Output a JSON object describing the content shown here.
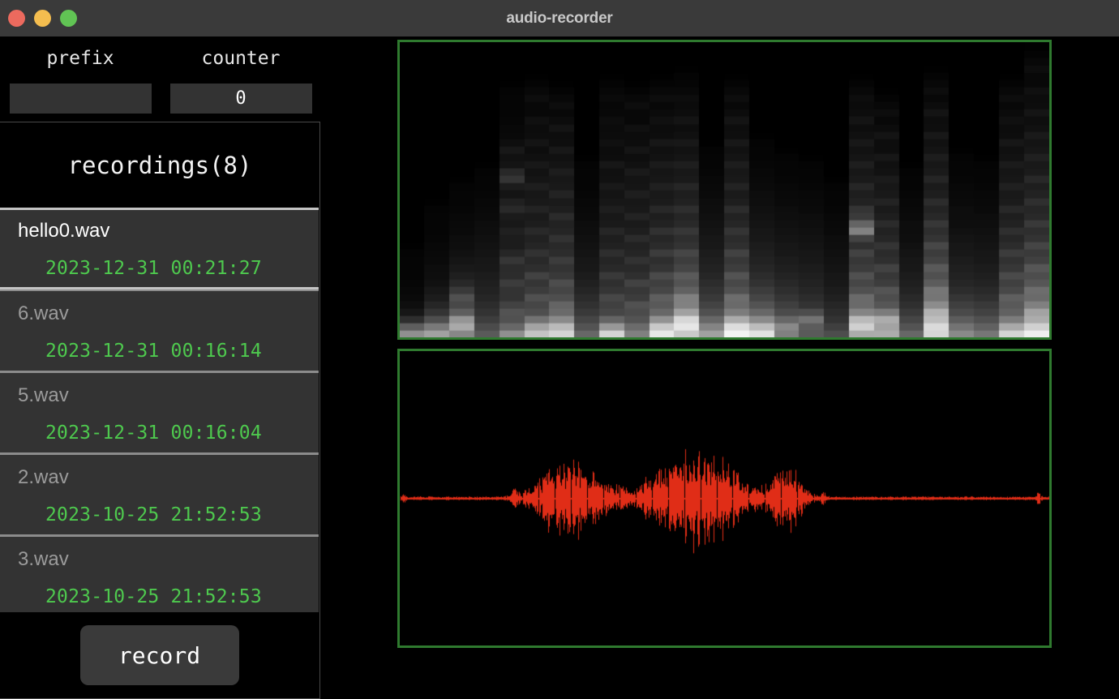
{
  "window": {
    "title": "audio-recorder",
    "traffic_lights": [
      {
        "name": "close-button",
        "color": "#ec6a5e"
      },
      {
        "name": "minimize-button",
        "color": "#f4bd4f"
      },
      {
        "name": "maximize-button",
        "color": "#61c454"
      }
    ],
    "titlebar_color": "#3a3a3a"
  },
  "form": {
    "prefix_label": "prefix",
    "counter_label": "counter",
    "prefix_value": "",
    "prefix_placeholder": "",
    "counter_value": "0"
  },
  "recordings": {
    "header": "recordings(8)",
    "count": 8,
    "items": [
      {
        "name": "hello0.wav",
        "timestamp": "2023-12-31 00:21:27",
        "selected": true
      },
      {
        "name": "6.wav",
        "timestamp": "2023-12-31 00:16:14",
        "selected": false
      },
      {
        "name": "5.wav",
        "timestamp": "2023-12-31 00:16:04",
        "selected": false
      },
      {
        "name": "2.wav",
        "timestamp": "2023-10-25 21:52:53",
        "selected": false
      },
      {
        "name": "3.wav",
        "timestamp": "2023-10-25 21:52:53",
        "selected": false
      }
    ]
  },
  "controls": {
    "record_label": "record"
  },
  "visualization": {
    "border_color": "#2f7a2f",
    "background_color": "#000000",
    "waveform_color": "#e02d17",
    "spectrogram_colormap": "grayscale",
    "spectrogram": {
      "columns": 26,
      "bins": 40,
      "magnitudes": [
        [
          0.55,
          0.28,
          0.1,
          0.05,
          0.03,
          0.02,
          0.02,
          0.01,
          0.01,
          0.01,
          0.01,
          0.01,
          0.0,
          0.0,
          0.0,
          0.0,
          0.0,
          0.0,
          0.0,
          0.0,
          0.0,
          0.0,
          0.0,
          0.0,
          0.0,
          0.0,
          0.0,
          0.0,
          0.0,
          0.0,
          0.0,
          0.0,
          0.0,
          0.0,
          0.0,
          0.0,
          0.0,
          0.0,
          0.0,
          0.0
        ],
        [
          0.62,
          0.4,
          0.22,
          0.14,
          0.1,
          0.07,
          0.05,
          0.04,
          0.03,
          0.03,
          0.02,
          0.02,
          0.02,
          0.01,
          0.01,
          0.01,
          0.01,
          0.01,
          0.0,
          0.0,
          0.0,
          0.0,
          0.0,
          0.0,
          0.0,
          0.0,
          0.0,
          0.0,
          0.0,
          0.0,
          0.0,
          0.0,
          0.0,
          0.0,
          0.0,
          0.0,
          0.0,
          0.0,
          0.0,
          0.0
        ],
        [
          0.4,
          0.7,
          0.55,
          0.25,
          0.18,
          0.3,
          0.14,
          0.1,
          0.08,
          0.06,
          0.05,
          0.04,
          0.03,
          0.03,
          0.02,
          0.02,
          0.02,
          0.01,
          0.01,
          0.01,
          0.01,
          0.0,
          0.0,
          0.0,
          0.0,
          0.0,
          0.0,
          0.0,
          0.0,
          0.0,
          0.0,
          0.0,
          0.0,
          0.0,
          0.0,
          0.0,
          0.0,
          0.0,
          0.0,
          0.0
        ],
        [
          0.3,
          0.22,
          0.18,
          0.14,
          0.12,
          0.1,
          0.09,
          0.08,
          0.07,
          0.06,
          0.05,
          0.05,
          0.04,
          0.04,
          0.03,
          0.03,
          0.02,
          0.02,
          0.02,
          0.01,
          0.01,
          0.01,
          0.01,
          0.0,
          0.0,
          0.0,
          0.0,
          0.0,
          0.0,
          0.0,
          0.0,
          0.0,
          0.0,
          0.0,
          0.0,
          0.0,
          0.0,
          0.0,
          0.0,
          0.0
        ],
        [
          0.55,
          0.3,
          0.22,
          0.3,
          0.18,
          0.14,
          0.12,
          0.22,
          0.1,
          0.09,
          0.2,
          0.08,
          0.07,
          0.06,
          0.1,
          0.05,
          0.05,
          0.14,
          0.08,
          0.04,
          0.04,
          0.2,
          0.1,
          0.03,
          0.03,
          0.08,
          0.02,
          0.02,
          0.02,
          0.01,
          0.01,
          0.01,
          0.01,
          0.01,
          0.0,
          0.0,
          0.0,
          0.0,
          0.0,
          0.0
        ],
        [
          0.75,
          0.6,
          0.35,
          0.22,
          0.18,
          0.3,
          0.15,
          0.12,
          0.25,
          0.1,
          0.09,
          0.18,
          0.08,
          0.07,
          0.14,
          0.06,
          0.05,
          0.12,
          0.05,
          0.04,
          0.1,
          0.04,
          0.03,
          0.08,
          0.03,
          0.02,
          0.06,
          0.02,
          0.02,
          0.05,
          0.01,
          0.01,
          0.04,
          0.01,
          0.01,
          0.0,
          0.0,
          0.0,
          0.0,
          0.0
        ],
        [
          0.82,
          0.72,
          0.45,
          0.3,
          0.36,
          0.22,
          0.18,
          0.28,
          0.14,
          0.12,
          0.22,
          0.1,
          0.09,
          0.18,
          0.08,
          0.07,
          0.15,
          0.06,
          0.05,
          0.12,
          0.05,
          0.04,
          0.1,
          0.03,
          0.03,
          0.08,
          0.02,
          0.02,
          0.06,
          0.02,
          0.01,
          0.04,
          0.01,
          0.01,
          0.0,
          0.0,
          0.0,
          0.0,
          0.0,
          0.0
        ],
        [
          0.35,
          0.25,
          0.2,
          0.16,
          0.14,
          0.11,
          0.1,
          0.08,
          0.07,
          0.06,
          0.05,
          0.05,
          0.04,
          0.04,
          0.03,
          0.03,
          0.02,
          0.02,
          0.02,
          0.01,
          0.01,
          0.01,
          0.01,
          0.01,
          0.0,
          0.0,
          0.0,
          0.0,
          0.0,
          0.0,
          0.0,
          0.0,
          0.0,
          0.0,
          0.0,
          0.0,
          0.0,
          0.0,
          0.0,
          0.0
        ],
        [
          0.88,
          0.5,
          0.3,
          0.2,
          0.16,
          0.26,
          0.13,
          0.11,
          0.2,
          0.09,
          0.08,
          0.16,
          0.07,
          0.06,
          0.13,
          0.05,
          0.05,
          0.1,
          0.04,
          0.04,
          0.08,
          0.03,
          0.03,
          0.07,
          0.02,
          0.02,
          0.05,
          0.02,
          0.02,
          0.04,
          0.01,
          0.01,
          0.03,
          0.01,
          0.01,
          0.0,
          0.0,
          0.0,
          0.0,
          0.0
        ],
        [
          0.45,
          0.35,
          0.25,
          0.2,
          0.3,
          0.15,
          0.13,
          0.24,
          0.11,
          0.09,
          0.18,
          0.08,
          0.07,
          0.15,
          0.06,
          0.05,
          0.12,
          0.05,
          0.04,
          0.1,
          0.04,
          0.03,
          0.09,
          0.03,
          0.02,
          0.07,
          0.02,
          0.02,
          0.05,
          0.01,
          0.01,
          0.04,
          0.01,
          0.01,
          0.0,
          0.0,
          0.0,
          0.0,
          0.0,
          0.0
        ],
        [
          0.92,
          0.78,
          0.48,
          0.32,
          0.24,
          0.36,
          0.18,
          0.15,
          0.28,
          0.12,
          0.1,
          0.22,
          0.09,
          0.08,
          0.18,
          0.07,
          0.06,
          0.14,
          0.05,
          0.05,
          0.11,
          0.04,
          0.04,
          0.09,
          0.03,
          0.03,
          0.07,
          0.02,
          0.02,
          0.05,
          0.02,
          0.01,
          0.04,
          0.01,
          0.01,
          0.0,
          0.0,
          0.0,
          0.0,
          0.0
        ],
        [
          0.7,
          0.95,
          0.85,
          0.55,
          0.38,
          0.5,
          0.28,
          0.22,
          0.34,
          0.18,
          0.15,
          0.26,
          0.12,
          0.1,
          0.2,
          0.09,
          0.08,
          0.16,
          0.07,
          0.06,
          0.13,
          0.05,
          0.05,
          0.1,
          0.04,
          0.03,
          0.08,
          0.03,
          0.02,
          0.06,
          0.02,
          0.02,
          0.04,
          0.01,
          0.01,
          0.01,
          0.0,
          0.0,
          0.0,
          0.0
        ],
        [
          0.6,
          0.45,
          0.32,
          0.24,
          0.2,
          0.16,
          0.14,
          0.12,
          0.1,
          0.09,
          0.08,
          0.07,
          0.06,
          0.05,
          0.05,
          0.04,
          0.04,
          0.03,
          0.03,
          0.02,
          0.02,
          0.02,
          0.01,
          0.01,
          0.01,
          0.01,
          0.0,
          0.0,
          0.0,
          0.0,
          0.0,
          0.0,
          0.0,
          0.0,
          0.0,
          0.0,
          0.0,
          0.0,
          0.0,
          0.0
        ],
        [
          0.96,
          0.88,
          0.6,
          0.4,
          0.3,
          0.42,
          0.22,
          0.18,
          0.32,
          0.15,
          0.13,
          0.24,
          0.11,
          0.09,
          0.19,
          0.08,
          0.07,
          0.16,
          0.06,
          0.05,
          0.12,
          0.05,
          0.04,
          0.1,
          0.03,
          0.03,
          0.08,
          0.02,
          0.02,
          0.06,
          0.02,
          0.01,
          0.04,
          0.01,
          0.01,
          0.0,
          0.0,
          0.0,
          0.0,
          0.0
        ],
        [
          0.9,
          0.7,
          0.45,
          0.32,
          0.26,
          0.2,
          0.17,
          0.14,
          0.12,
          0.1,
          0.09,
          0.08,
          0.07,
          0.06,
          0.05,
          0.05,
          0.04,
          0.04,
          0.03,
          0.03,
          0.02,
          0.02,
          0.02,
          0.01,
          0.01,
          0.01,
          0.01,
          0.0,
          0.0,
          0.0,
          0.0,
          0.0,
          0.0,
          0.0,
          0.0,
          0.0,
          0.0,
          0.0,
          0.0,
          0.0
        ],
        [
          0.4,
          0.55,
          0.3,
          0.22,
          0.18,
          0.15,
          0.12,
          0.11,
          0.09,
          0.08,
          0.07,
          0.06,
          0.05,
          0.05,
          0.04,
          0.04,
          0.03,
          0.03,
          0.02,
          0.02,
          0.02,
          0.01,
          0.01,
          0.01,
          0.01,
          0.0,
          0.0,
          0.0,
          0.0,
          0.0,
          0.0,
          0.0,
          0.0,
          0.0,
          0.0,
          0.0,
          0.0,
          0.0,
          0.0,
          0.0
        ],
        [
          0.3,
          0.22,
          0.5,
          0.18,
          0.14,
          0.12,
          0.1,
          0.09,
          0.08,
          0.07,
          0.06,
          0.05,
          0.05,
          0.04,
          0.04,
          0.03,
          0.03,
          0.02,
          0.02,
          0.02,
          0.01,
          0.01,
          0.01,
          0.01,
          0.0,
          0.0,
          0.0,
          0.0,
          0.0,
          0.0,
          0.0,
          0.0,
          0.0,
          0.0,
          0.0,
          0.0,
          0.0,
          0.0,
          0.0,
          0.0
        ],
        [
          0.25,
          0.18,
          0.14,
          0.12,
          0.1,
          0.08,
          0.07,
          0.06,
          0.05,
          0.05,
          0.04,
          0.04,
          0.03,
          0.03,
          0.02,
          0.02,
          0.02,
          0.01,
          0.01,
          0.01,
          0.01,
          0.0,
          0.0,
          0.0,
          0.0,
          0.0,
          0.0,
          0.0,
          0.0,
          0.0,
          0.0,
          0.0,
          0.0,
          0.0,
          0.0,
          0.0,
          0.0,
          0.0,
          0.0,
          0.0
        ],
        [
          0.55,
          0.88,
          0.7,
          0.42,
          0.3,
          0.4,
          0.22,
          0.18,
          0.3,
          0.15,
          0.13,
          0.24,
          0.11,
          0.09,
          0.6,
          0.3,
          0.12,
          0.18,
          0.07,
          0.06,
          0.13,
          0.05,
          0.04,
          0.1,
          0.04,
          0.03,
          0.08,
          0.03,
          0.02,
          0.06,
          0.02,
          0.02,
          0.04,
          0.01,
          0.01,
          0.0,
          0.0,
          0.0,
          0.0,
          0.0
        ],
        [
          0.65,
          0.5,
          0.75,
          0.35,
          0.26,
          0.2,
          0.32,
          0.15,
          0.13,
          0.24,
          0.11,
          0.09,
          0.19,
          0.08,
          0.07,
          0.15,
          0.06,
          0.05,
          0.12,
          0.05,
          0.04,
          0.09,
          0.03,
          0.03,
          0.07,
          0.02,
          0.02,
          0.06,
          0.02,
          0.01,
          0.04,
          0.01,
          0.01,
          0.0,
          0.0,
          0.0,
          0.0,
          0.0,
          0.0,
          0.0
        ],
        [
          0.35,
          0.25,
          0.2,
          0.16,
          0.13,
          0.11,
          0.09,
          0.08,
          0.07,
          0.06,
          0.05,
          0.05,
          0.04,
          0.03,
          0.03,
          0.03,
          0.02,
          0.02,
          0.02,
          0.01,
          0.01,
          0.01,
          0.01,
          0.0,
          0.0,
          0.0,
          0.0,
          0.0,
          0.0,
          0.0,
          0.0,
          0.0,
          0.0,
          0.0,
          0.0,
          0.0,
          0.0,
          0.0,
          0.0,
          0.0
        ],
        [
          0.78,
          0.92,
          0.62,
          0.72,
          0.45,
          0.34,
          0.46,
          0.26,
          0.21,
          0.34,
          0.17,
          0.14,
          0.27,
          0.12,
          0.1,
          0.2,
          0.09,
          0.07,
          0.16,
          0.06,
          0.05,
          0.13,
          0.05,
          0.04,
          0.1,
          0.03,
          0.03,
          0.08,
          0.02,
          0.02,
          0.06,
          0.02,
          0.01,
          0.04,
          0.01,
          0.01,
          0.0,
          0.0,
          0.0,
          0.0
        ],
        [
          0.5,
          0.38,
          0.28,
          0.22,
          0.18,
          0.15,
          0.12,
          0.1,
          0.09,
          0.08,
          0.07,
          0.06,
          0.05,
          0.05,
          0.04,
          0.03,
          0.03,
          0.03,
          0.02,
          0.02,
          0.02,
          0.01,
          0.01,
          0.01,
          0.01,
          0.0,
          0.0,
          0.0,
          0.0,
          0.0,
          0.0,
          0.0,
          0.0,
          0.0,
          0.0,
          0.0,
          0.0,
          0.0,
          0.0,
          0.0
        ],
        [
          0.42,
          0.3,
          0.24,
          0.19,
          0.16,
          0.13,
          0.11,
          0.09,
          0.08,
          0.07,
          0.06,
          0.05,
          0.05,
          0.04,
          0.04,
          0.03,
          0.03,
          0.02,
          0.02,
          0.02,
          0.01,
          0.01,
          0.01,
          0.01,
          0.0,
          0.0,
          0.0,
          0.0,
          0.0,
          0.0,
          0.0,
          0.0,
          0.0,
          0.0,
          0.0,
          0.0,
          0.0,
          0.0,
          0.0,
          0.0
        ],
        [
          0.85,
          0.6,
          0.4,
          0.3,
          0.24,
          0.36,
          0.19,
          0.16,
          0.28,
          0.13,
          0.11,
          0.22,
          0.1,
          0.08,
          0.17,
          0.07,
          0.06,
          0.14,
          0.05,
          0.05,
          0.11,
          0.04,
          0.04,
          0.09,
          0.03,
          0.03,
          0.07,
          0.02,
          0.02,
          0.05,
          0.02,
          0.01,
          0.04,
          0.01,
          0.01,
          0.0,
          0.0,
          0.0,
          0.0,
          0.0
        ],
        [
          0.95,
          0.8,
          0.55,
          0.65,
          0.4,
          0.3,
          0.42,
          0.24,
          0.2,
          0.33,
          0.16,
          0.14,
          0.26,
          0.12,
          0.1,
          0.21,
          0.09,
          0.08,
          0.17,
          0.07,
          0.06,
          0.14,
          0.05,
          0.05,
          0.11,
          0.04,
          0.03,
          0.09,
          0.03,
          0.02,
          0.07,
          0.02,
          0.02,
          0.05,
          0.01,
          0.01,
          0.04,
          0.01,
          0.01,
          0.0
        ]
      ]
    },
    "waveform": {
      "samples": 760,
      "baseline_amplitude": 0.012,
      "bursts": [
        {
          "center": 0.262,
          "width": 0.055,
          "peak": 0.3
        },
        {
          "center": 0.455,
          "width": 0.075,
          "peak": 0.34
        },
        {
          "center": 0.595,
          "width": 0.03,
          "peak": 0.21
        }
      ],
      "small_blips": [
        {
          "center": 0.175,
          "width": 0.006,
          "peak": 0.045
        },
        {
          "center": 0.34,
          "width": 0.008,
          "peak": 0.03
        },
        {
          "center": 0.385,
          "width": 0.01,
          "peak": 0.035
        },
        {
          "center": 0.515,
          "width": 0.008,
          "peak": 0.035
        },
        {
          "center": 0.545,
          "width": 0.006,
          "peak": 0.028
        },
        {
          "center": 0.652,
          "width": 0.005,
          "peak": 0.04
        },
        {
          "center": 0.985,
          "width": 0.004,
          "peak": 0.05
        },
        {
          "center": 0.005,
          "width": 0.004,
          "peak": 0.04
        }
      ]
    }
  }
}
